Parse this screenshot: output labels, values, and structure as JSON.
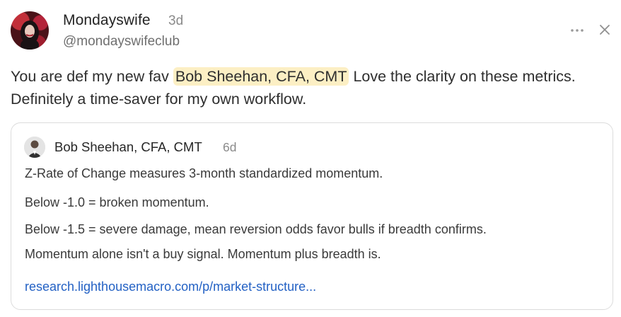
{
  "post": {
    "author": {
      "name": "Mondayswife",
      "time": "3d",
      "handle": "@mondayswifeclub",
      "avatar_icon": "profile-photo"
    },
    "text_before": "You are def my new fav ",
    "mention": "Bob Sheehan, CFA, CMT",
    "text_after": " Love the clarity on these metrics. Definitely a time-saver for my own workflow.",
    "actions": {
      "more_icon": "ellipsis-icon",
      "close_icon": "close-icon"
    }
  },
  "quote": {
    "author": {
      "name": "Bob Sheehan, CFA, CMT",
      "time": "6d"
    },
    "lines": [
      "Z-Rate of Change measures 3-month standardized momentum.",
      "Below -1.0 = broken momentum.",
      "Below -1.5 = severe damage, mean reversion odds favor bulls if breadth confirms.",
      "Momentum alone isn't a buy signal. Momentum plus breadth is."
    ],
    "link": "research.lighthousemacro.com/p/market-structure..."
  },
  "colors": {
    "mention_highlight": "#fcefc4",
    "link": "#2361c4",
    "muted": "#8a8a8a"
  }
}
